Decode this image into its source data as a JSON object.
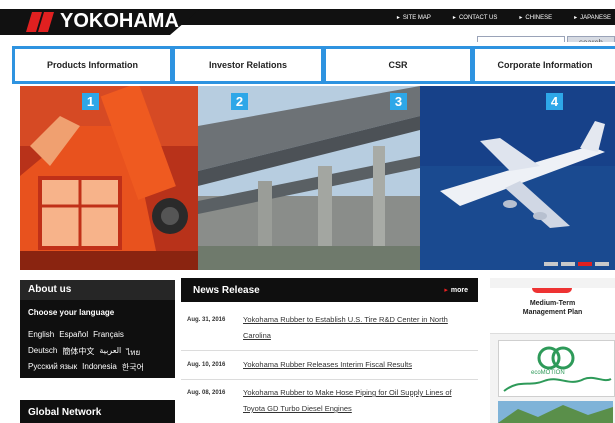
{
  "header": {
    "logo_text": "YOKOHAMA",
    "util_links": [
      "SITE MAP",
      "CONTACT US",
      "CHINESE",
      "JAPANESE"
    ],
    "search_button": "search",
    "search_placeholder": ""
  },
  "nav": {
    "items": [
      "Products Information",
      "Investor Relations",
      "CSR",
      "Corporate Information"
    ]
  },
  "hero": {
    "badges": [
      "1",
      "2",
      "3",
      "4"
    ],
    "slide_count": 4,
    "active_slide": 3
  },
  "about": {
    "title": "About us",
    "choose_language": "Choose your language",
    "lang_row_1": [
      "English",
      "Español",
      "Français"
    ],
    "lang_row_2": [
      "Deutsch",
      "簡体中文",
      "العربية",
      "ไทย"
    ],
    "lang_row_3": [
      "Русский язык",
      "Indonesia",
      "한국어"
    ]
  },
  "global": {
    "title": "Global Network"
  },
  "news": {
    "title": "News Release",
    "more": "more",
    "items": [
      {
        "date": "Aug. 31, 2016",
        "title": "Yokohama Rubber to Establish U.S. Tire R&D Center in North Carolina"
      },
      {
        "date": "Aug. 10, 2016",
        "title": "Yokohama Rubber Releases Interim Fiscal Results"
      },
      {
        "date": "Aug. 08, 2016",
        "title": "Yokohama Rubber to Make Hose Piping for Oil Supply Lines of Toyota GD Turbo Diesel Engines"
      }
    ]
  },
  "banners": {
    "plan_line_1": "Medium-Term",
    "plan_line_2": "Management Plan",
    "eco_text": "ecoMOTION"
  },
  "colors": {
    "outline_blue": "#2e93e0",
    "badge_blue": "#2ea7e8",
    "brand_red": "#e02020",
    "frame_navy": "#1d3b80"
  }
}
